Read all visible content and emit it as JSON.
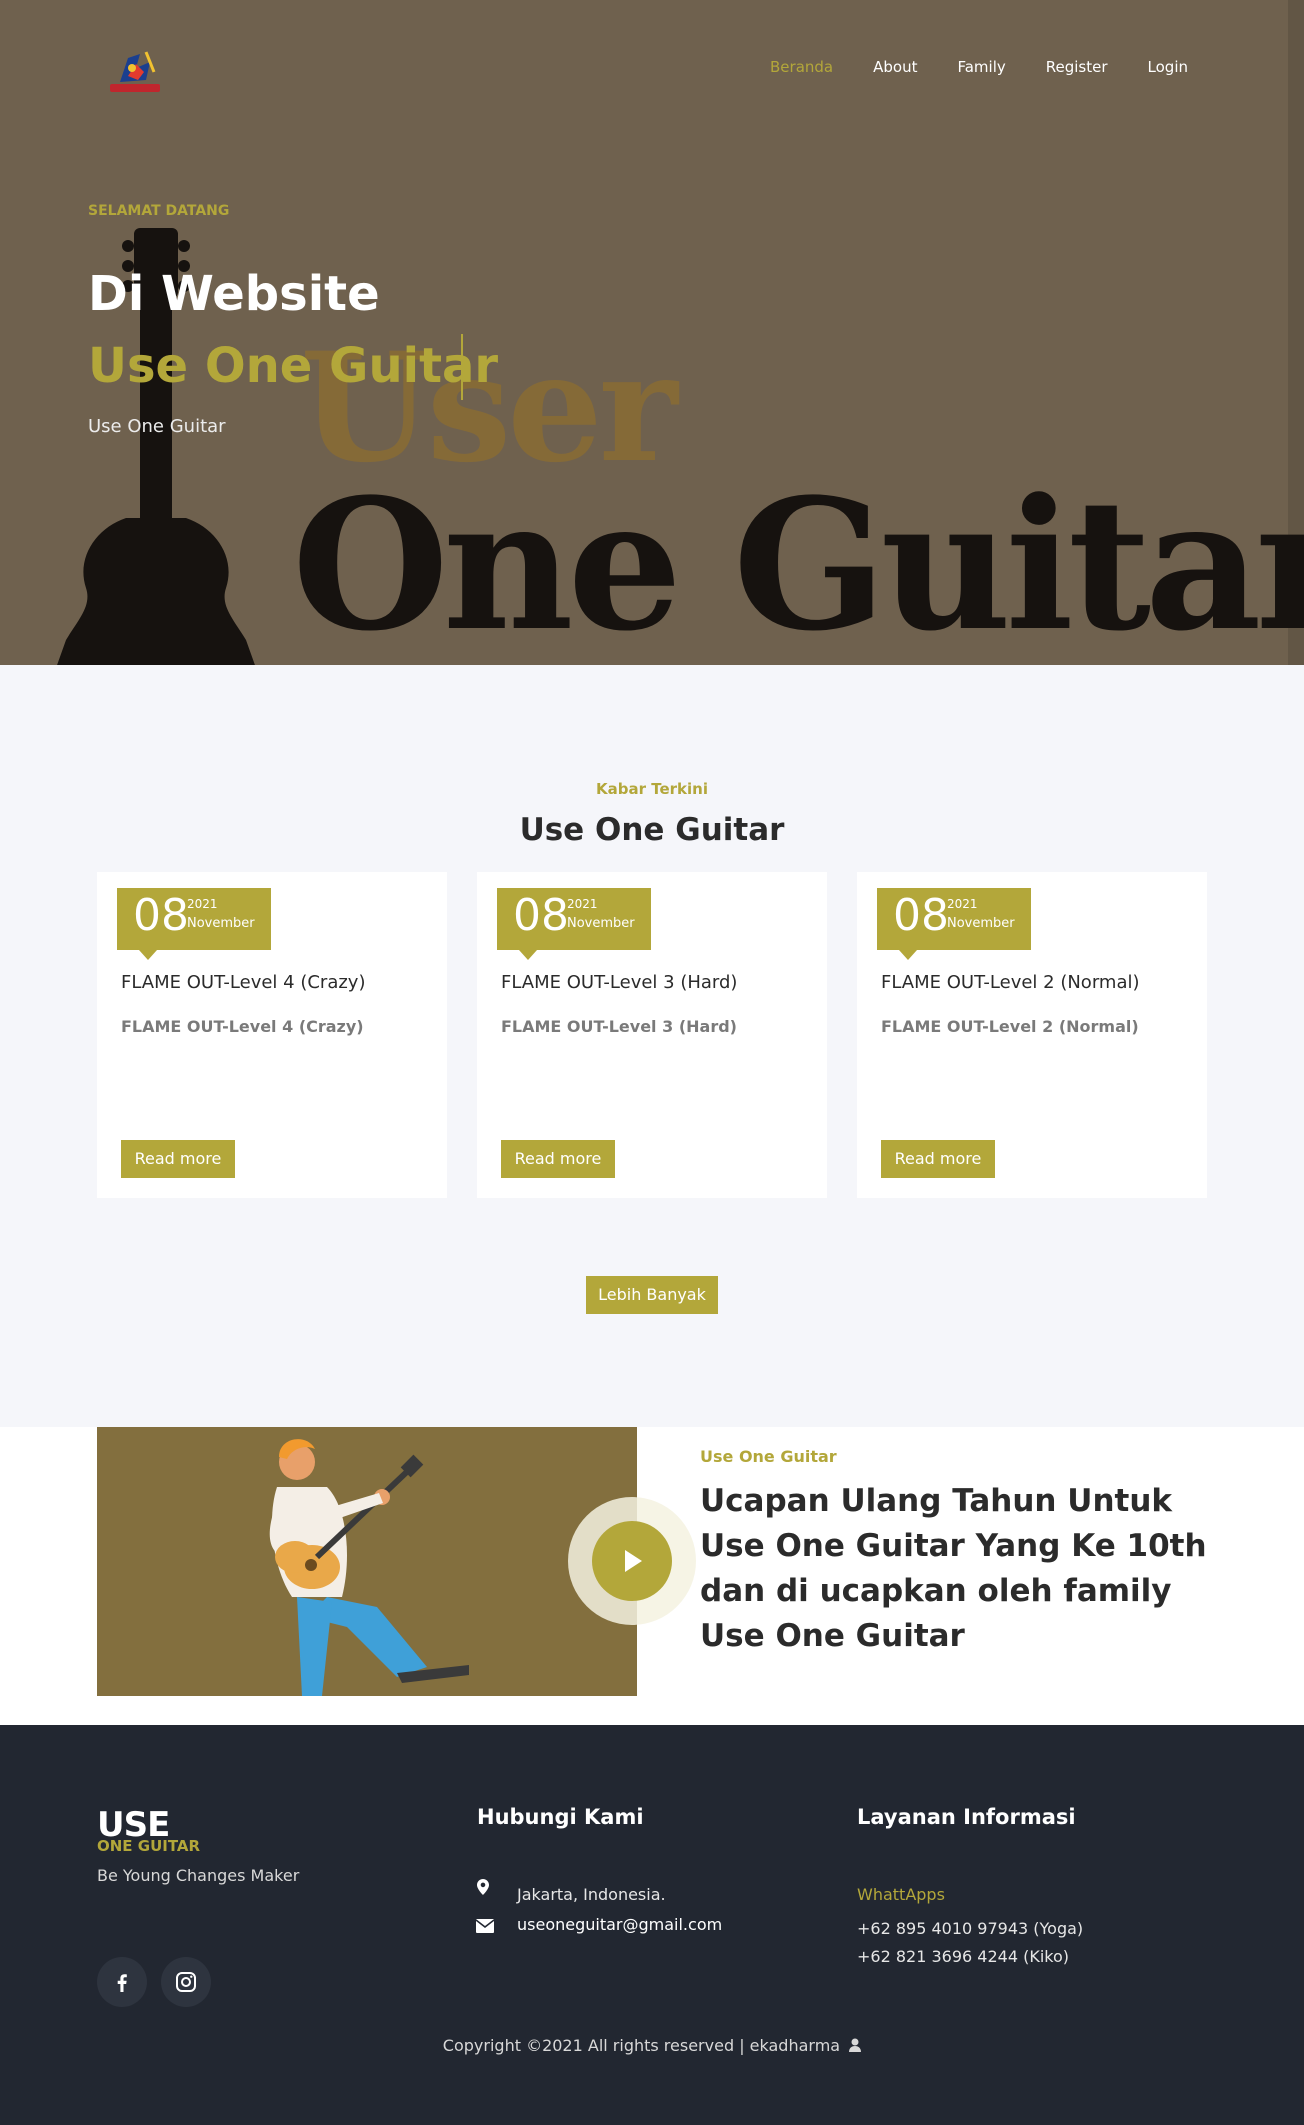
{
  "colors": {
    "accent": "#b3a73a",
    "hero_bg": "#6f614e",
    "footer_bg": "#222731",
    "video_bg": "#836f3e"
  },
  "nav": {
    "items": [
      {
        "label": "Beranda",
        "active": true
      },
      {
        "label": "About",
        "active": false
      },
      {
        "label": "Family",
        "active": false
      },
      {
        "label": "Register",
        "active": false
      },
      {
        "label": "Login",
        "active": false
      }
    ]
  },
  "hero": {
    "kicker": "SELAMAT DATANG",
    "title_line1": "Di Website",
    "title_line2": "Use One Guitar",
    "subtitle": "Use One Guitar",
    "bg_word1": "User",
    "bg_word2": "One Guitar"
  },
  "news": {
    "kicker": "Kabar Terkini",
    "title": "Use One Guitar",
    "cards": [
      {
        "day": "08",
        "year": "2021",
        "month": "November",
        "title": "FLAME OUT-Level 4 (Crazy)",
        "subtitle": "FLAME OUT-Level 4 (Crazy)",
        "button": "Read more"
      },
      {
        "day": "08",
        "year": "2021",
        "month": "November",
        "title": "FLAME OUT-Level 3 (Hard)",
        "subtitle": "FLAME OUT-Level 3 (Hard)",
        "button": "Read more"
      },
      {
        "day": "08",
        "year": "2021",
        "month": "November",
        "title": "FLAME OUT-Level 2 (Normal)",
        "subtitle": "FLAME OUT-Level 2 (Normal)",
        "button": "Read more"
      }
    ],
    "more_button": "Lebih Banyak"
  },
  "video": {
    "kicker": "Use One Guitar",
    "title": "Ucapan Ulang Tahun Untuk Use One Guitar Yang Ke 10th dan di ucapkan oleh family Use One Guitar"
  },
  "footer": {
    "brand_top": "USE",
    "brand_bottom": "ONE GUITAR",
    "tagline": "Be Young Changes Maker",
    "contact_heading": "Hubungi Kami",
    "address": "Jakarta, Indonesia.",
    "email": "useoneguitar@gmail.com",
    "info_heading": "Layanan Informasi",
    "whatsapp_label": "WhattApps",
    "phone1": "+62 895 4010 97943 (Yoga)",
    "phone2": "+62 821 3696 4244 (Kiko)",
    "copyright": "Copyright ©2021 All rights reserved | ekadharma"
  }
}
